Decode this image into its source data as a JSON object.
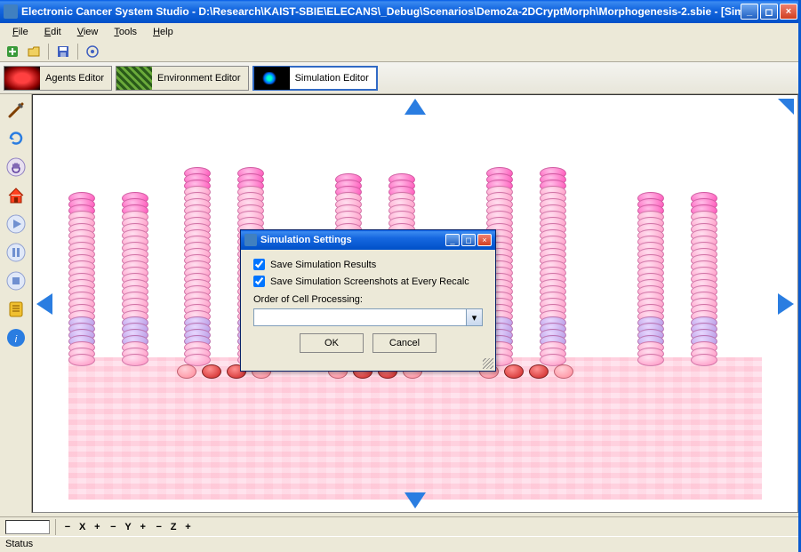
{
  "titlebar": {
    "text": "Electronic Cancer System Studio - D:\\Research\\KAIST-SBIE\\ELECANS\\_Debug\\Scenarios\\Demo2a-2DCryptMorph\\Morphogenesis-2.sbie - [Simulation Editor ]"
  },
  "menu": {
    "file": "File",
    "edit": "Edit",
    "view": "View",
    "tools": "Tools",
    "help": "Help"
  },
  "tabs": {
    "agents": "Agents Editor",
    "environment": "Environment Editor",
    "simulation": "Simulation Editor"
  },
  "axis": {
    "x": "X",
    "y": "Y",
    "z": "Z",
    "minus": "−",
    "plus": "+"
  },
  "statusbar": {
    "text": "Status"
  },
  "dialog": {
    "title": "Simulation Settings",
    "save_results": "Save Simulation Results",
    "save_screenshots": "Save Simulation Screenshots at Every Recalc",
    "order_label": "Order of Cell Processing:",
    "order_value": "",
    "ok": "OK",
    "cancel": "Cancel"
  }
}
